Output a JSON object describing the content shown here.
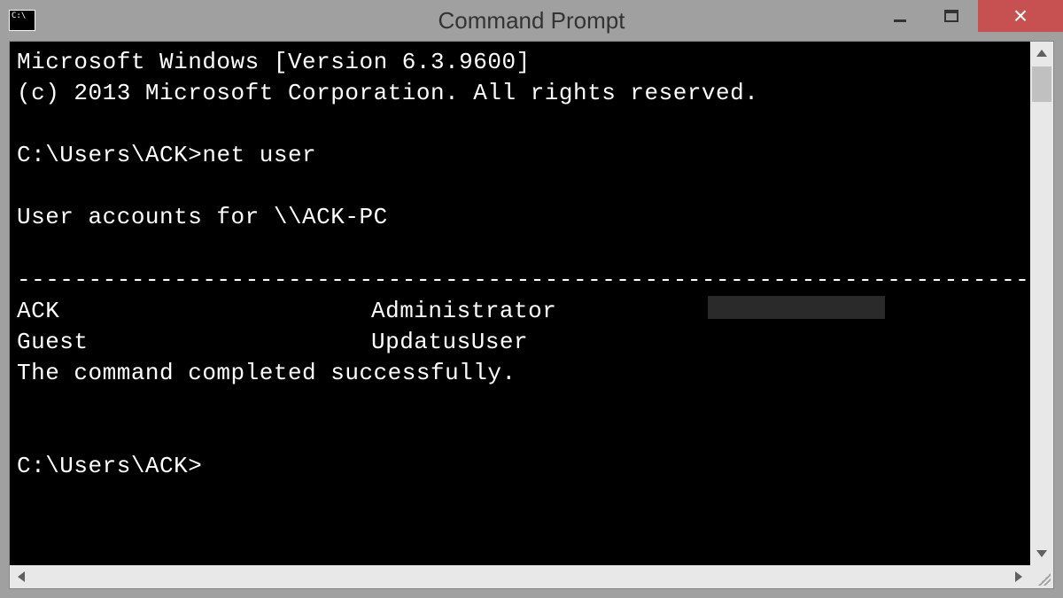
{
  "window": {
    "title": "Command Prompt"
  },
  "console": {
    "header1": "Microsoft Windows [Version 6.3.9600]",
    "header2": "(c) 2013 Microsoft Corporation. All rights reserved.",
    "prompt1": "C:\\Users\\ACK>",
    "command1": "net user",
    "accounts_header": "User accounts for \\\\ACK-PC",
    "divider": "-------------------------------------------------------------------------------",
    "users_row1": {
      "c1": "ACK",
      "c2": "Administrator"
    },
    "users_row2": {
      "c1": "Guest",
      "c2": "UpdatusUser"
    },
    "success": "The command completed successfully.",
    "prompt2": "C:\\Users\\ACK>"
  }
}
